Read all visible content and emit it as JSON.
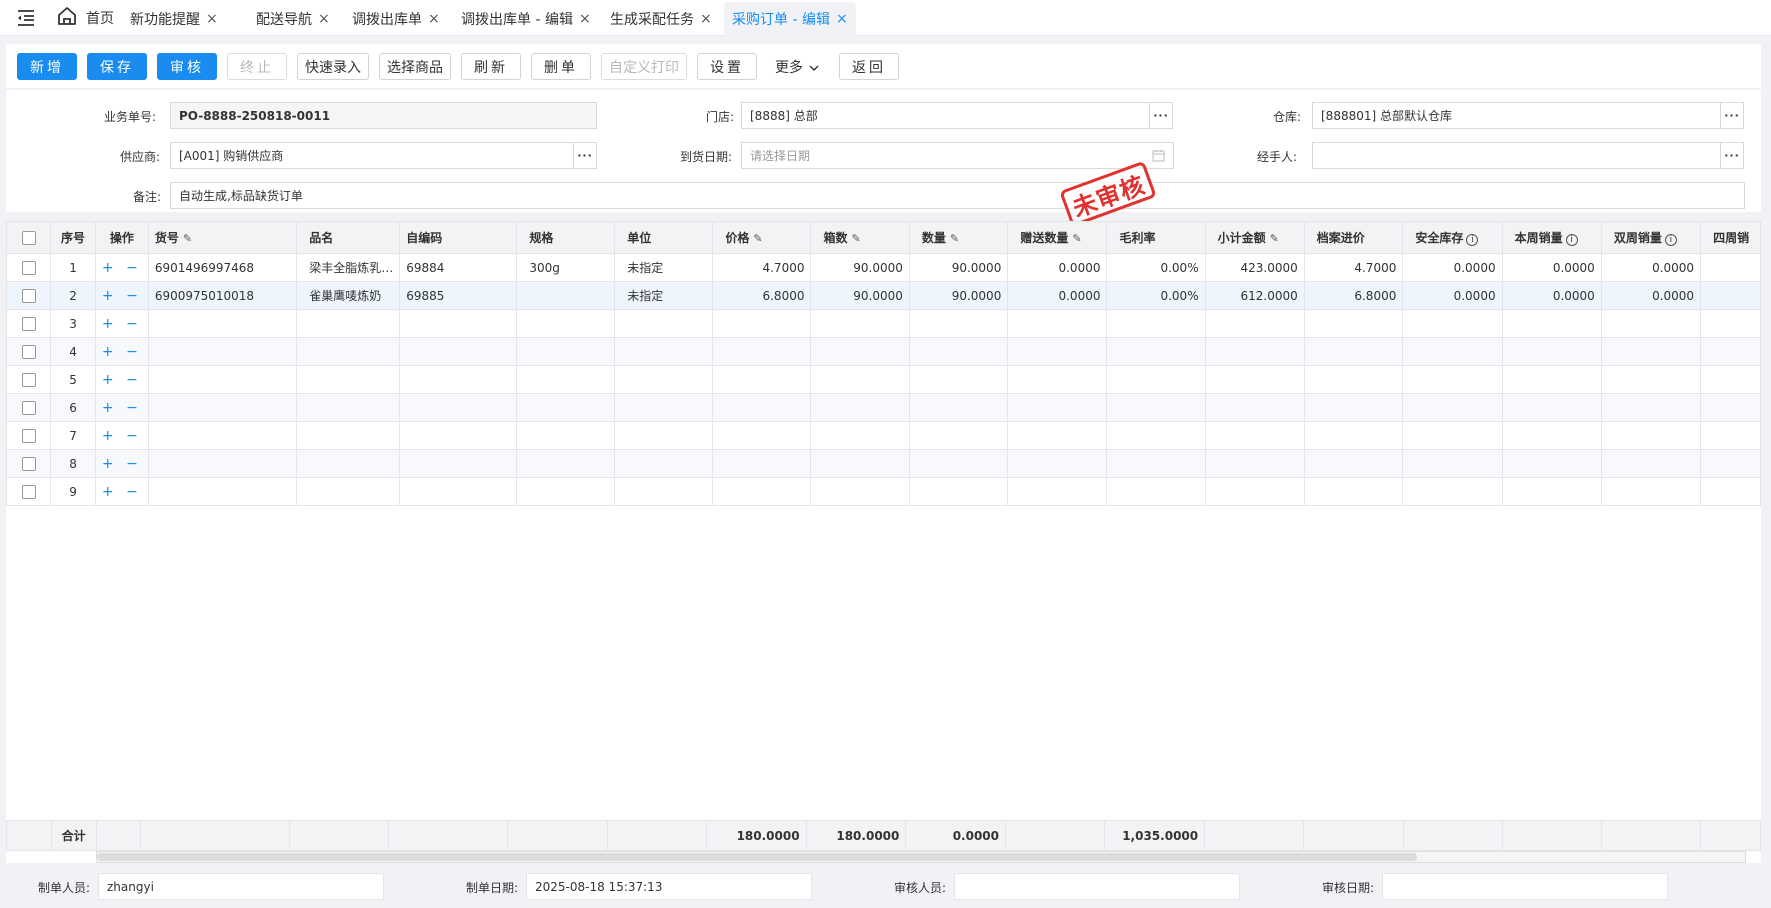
{
  "tabs": {
    "home": "首页",
    "items": [
      "新功能提醒",
      "配送导航",
      "调拨出库单",
      "调拨出库单 - 编辑",
      "生成采配任务",
      "采购订单 - 编辑"
    ],
    "close": "×"
  },
  "toolbar": {
    "new": "新增",
    "save": "保存",
    "audit": "审核",
    "stop": "终止",
    "quick_entry": "快速录入",
    "select_goods": "选择商品",
    "refresh": "刷新",
    "delete": "删单",
    "custom_print": "自定义打印",
    "settings": "设置",
    "more": "更多",
    "back": "返回"
  },
  "form": {
    "order_no_label": "业务单号:",
    "order_no": "PO-8888-250818-0011",
    "store_label": "门店:",
    "store": "[8888] 总部",
    "warehouse_label": "仓库:",
    "warehouse": "[888801] 总部默认仓库",
    "supplier_label": "供应商:",
    "supplier": "[A001] 购销供应商",
    "arrival_label": "到货日期:",
    "arrival_placeholder": "请选择日期",
    "handler_label": "经手人:",
    "handler": "",
    "remark_label": "备注:",
    "remark": "自动生成,标品缺货订单",
    "ellipsis": "···"
  },
  "stamp": "未审核",
  "table": {
    "headers": [
      "序号",
      "操作",
      "货号",
      "品名",
      "自编码",
      "规格",
      "单位",
      "价格",
      "箱数",
      "数量",
      "赠送数量",
      "毛利率",
      "小计金额",
      "档案进价",
      "安全库存",
      "本周销量",
      "双周销量",
      "四周销"
    ],
    "rows": [
      {
        "no": "1",
        "sku": "6901496997468",
        "name": "梁丰全脂炼乳…",
        "code": "69884",
        "spec": "300g",
        "unit": "未指定",
        "price": "4.7000",
        "boxes": "90.0000",
        "qty": "90.0000",
        "gift": "0.0000",
        "margin": "0.00%",
        "subtotal": "423.0000",
        "cost": "4.7000",
        "safety": "0.0000",
        "week": "0.0000",
        "biweek": "0.0000"
      },
      {
        "no": "2",
        "sku": "6900975010018",
        "name": "雀巢鹰唛炼奶",
        "code": "69885",
        "spec": "",
        "unit": "未指定",
        "price": "6.8000",
        "boxes": "90.0000",
        "qty": "90.0000",
        "gift": "0.0000",
        "margin": "0.00%",
        "subtotal": "612.0000",
        "cost": "6.8000",
        "safety": "0.0000",
        "week": "0.0000",
        "biweek": "0.0000"
      },
      {
        "no": "3"
      },
      {
        "no": "4"
      },
      {
        "no": "5"
      },
      {
        "no": "6"
      },
      {
        "no": "7"
      },
      {
        "no": "8"
      },
      {
        "no": "9"
      }
    ],
    "ops": "+ −",
    "total_label": "合计",
    "total_boxes": "180.0000",
    "total_qty": "180.0000",
    "total_gift": "0.0000",
    "total_subtotal": "1,035.0000"
  },
  "footer": {
    "creator_label": "制单人员:",
    "creator": "zhangyi",
    "created_label": "制单日期:",
    "created": "2025-08-18 15:37:13",
    "auditor_label": "审核人员:",
    "auditor": "",
    "audit_date_label": "审核日期:",
    "audit_date": ""
  }
}
